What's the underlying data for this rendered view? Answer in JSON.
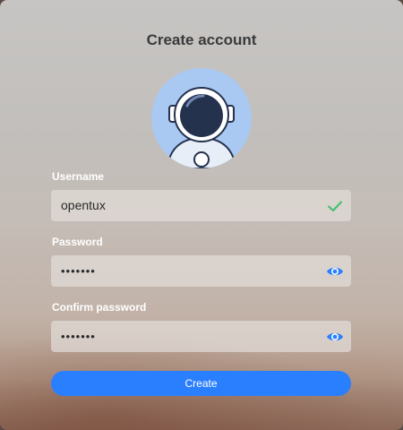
{
  "window": {
    "title": "Create account"
  },
  "form": {
    "username_label": "Username",
    "username_value": "opentux",
    "password_label": "Password",
    "password_value": "•••••••",
    "confirm_label": "Confirm password",
    "confirm_value": "•••••••",
    "create_label": "Create"
  },
  "icons": {
    "avatar": "astronaut-avatar-icon",
    "username_status": "checkmark-icon",
    "password_reveal": "eye-icon",
    "confirm_reveal": "eye-icon"
  },
  "colors": {
    "accent": "#2a7fff",
    "valid": "#3fbf6f",
    "avatar_bg": "#a9c8f2",
    "visor": "#24324e"
  }
}
